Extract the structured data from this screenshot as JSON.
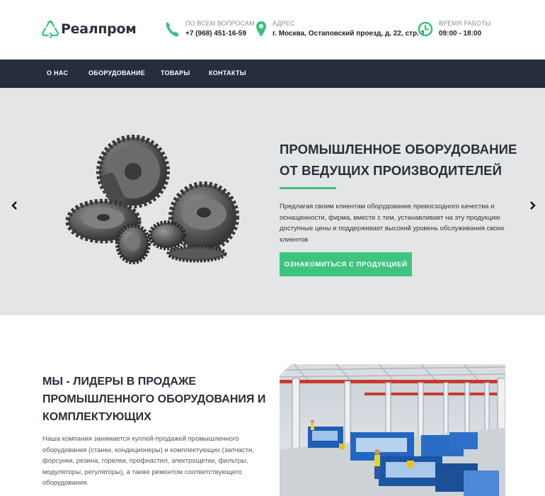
{
  "brand": {
    "name": "Реалпром",
    "accent_color": "#3cc07a"
  },
  "header": {
    "phone": {
      "icon": "phone-icon",
      "caption": "ПО ВСЕМ ВОПРОСАМ",
      "value": "+7 (968) 451-16-59"
    },
    "address": {
      "icon": "map-pin-icon",
      "caption": "АДРЕС",
      "value": "г. Москва, Остаповский проезд, д. 22, стр. 1"
    },
    "hours": {
      "icon": "clock-icon",
      "caption": "ВРЕМЯ РАБОТЫ",
      "value": "09:00 - 18:00"
    }
  },
  "nav": {
    "background": "#252d3e",
    "items": [
      {
        "label": "О НАС"
      },
      {
        "label": "ОБОРУДОВАНИЕ"
      },
      {
        "label": "ТОВАРЫ"
      },
      {
        "label": "КОНТАКТЫ"
      }
    ]
  },
  "hero": {
    "title_line1": "ПРОМЫШЛЕННОЕ ОБОРУДОВАНИЕ",
    "title_line2": "ОТ ВЕДУЩИХ ПРОИЗВОДИТЕЛЕЙ",
    "text": "Предлагая своим клиентам оборудование превосходного качества и оснащенности, фирма, вместе с тем, устанавливает на эту продукцию доступные цены и поддерживает высокий уровень обслуживания своих клиентов",
    "button_label": "ОЗНАКОМИТЬСЯ С ПРОДУКЦИЕЙ",
    "prev_icon": "chevron-left-icon",
    "next_icon": "chevron-right-icon",
    "image": "gears-image"
  },
  "about": {
    "title_line1": "МЫ - ЛИДЕРЫ В ПРОДАЖЕ",
    "title_line2": "ПРОМЫШЛЕННОГО ОБОРУДОВАНИЯ И",
    "title_line3": "КОМПЛЕКТУЮЩИХ",
    "text": "Наша компания занимается куплей-продажей промышленного оборудования (станки, кондиционеры) и комплектующих (запчасти, форсунки, резина, горелки, профнастил, электрощетки, фильтры, модуляторы, регуляторы), а также ремонтом соответствующего оборудования.",
    "image": "factory-image"
  }
}
